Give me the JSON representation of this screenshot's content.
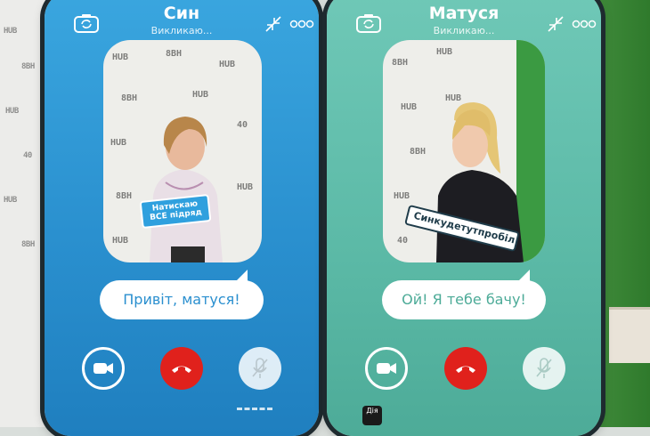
{
  "scene": {
    "backdrop_tags": [
      "HUB",
      "40",
      "8ВН",
      "HUB",
      "40",
      "8ВН"
    ]
  },
  "left_phone": {
    "caller_name": "Син",
    "call_status": "Викликаю...",
    "message": "Привіт, матуся!",
    "sign_text": "Натискаю ВСЕ підряд",
    "accent": "#2a90cf"
  },
  "right_phone": {
    "caller_name": "Матуся",
    "call_status": "Викликаю...",
    "message": "Ой! Я тебе бачу!",
    "sign_text": "Синкудетутпробіл",
    "badge": "Дія",
    "accent": "#5bb9a6"
  },
  "colors": {
    "hangup": "#e0211c",
    "wall_green": "#2f7a2c"
  },
  "icons": [
    "camera-switch-icon",
    "shrink-icon",
    "more-icon",
    "video-icon",
    "hangup-icon",
    "mic-off-icon"
  ]
}
